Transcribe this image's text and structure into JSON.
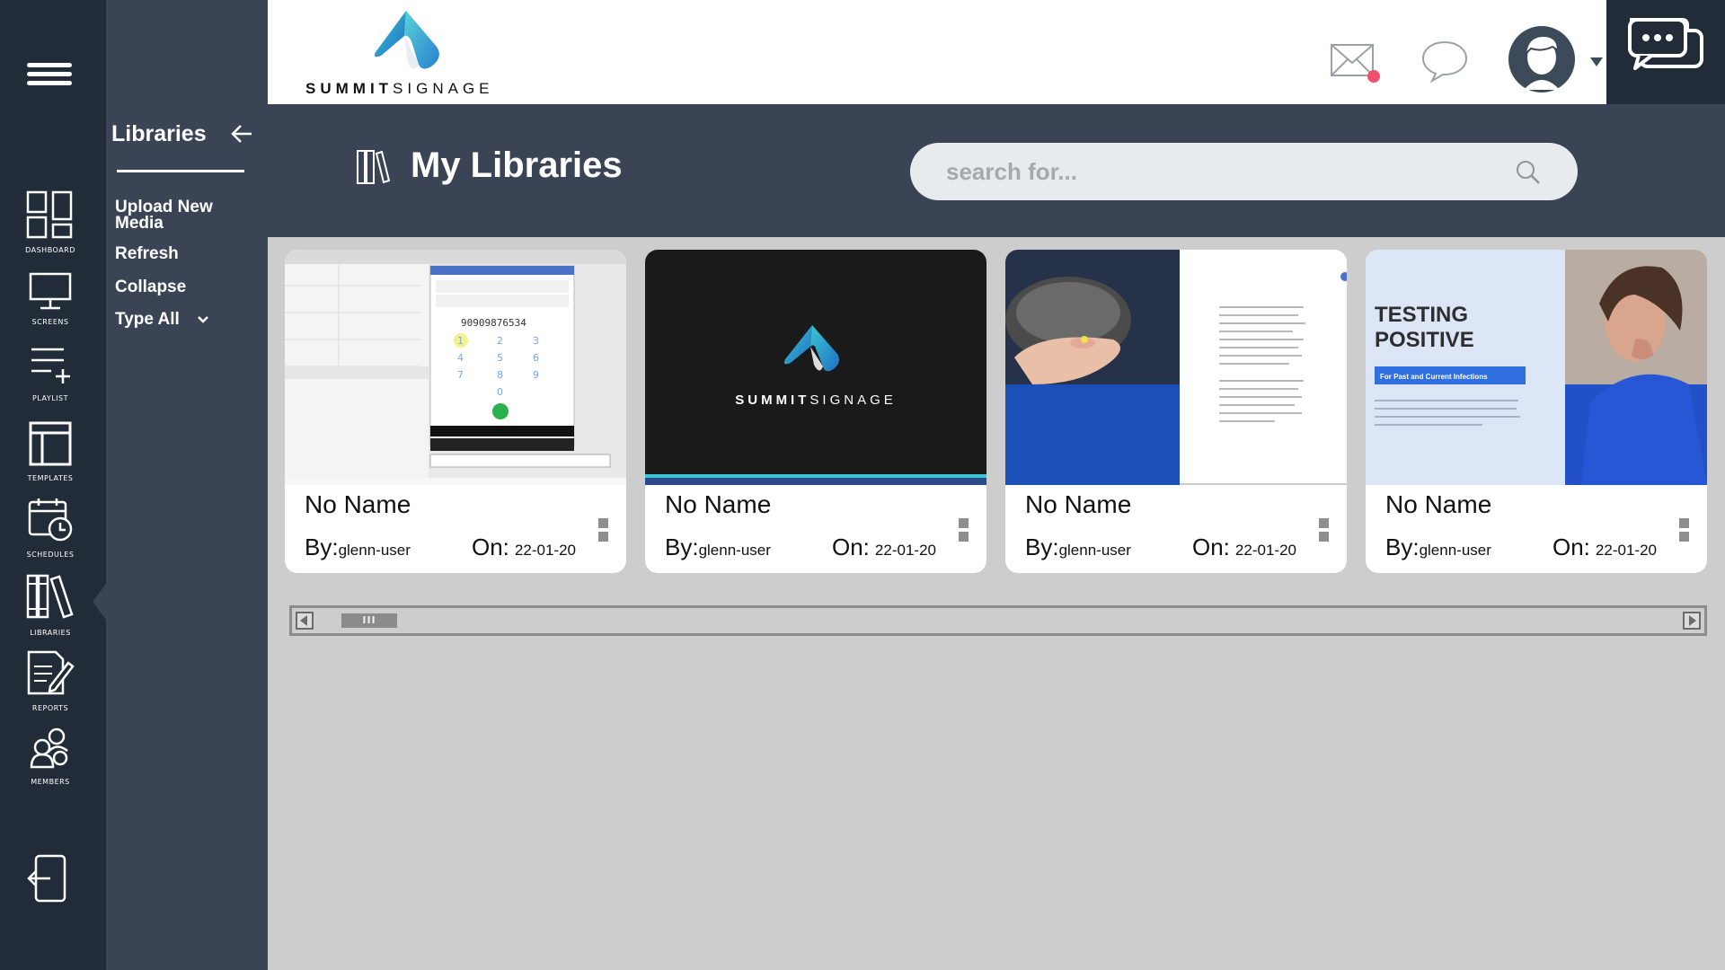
{
  "brand": {
    "name_bold": "SUMMIT",
    "name_light": "SIGNAGE"
  },
  "nav": {
    "items": [
      {
        "label": "Dashboard",
        "icon": "dashboard-icon"
      },
      {
        "label": "Screens",
        "icon": "monitor-icon"
      },
      {
        "label": "Playlist",
        "icon": "playlist-add-icon"
      },
      {
        "label": "Templates",
        "icon": "template-layout-icon"
      },
      {
        "label": "Schedules",
        "icon": "calendar-clock-icon"
      },
      {
        "label": "Libraries",
        "icon": "library-books-icon",
        "active": true
      },
      {
        "label": "Reports",
        "icon": "report-edit-icon"
      },
      {
        "label": "Members",
        "icon": "members-group-icon"
      }
    ],
    "logout_icon": "logout-icon"
  },
  "panel": {
    "title": "Libraries",
    "items": [
      "Upload New Media",
      "Refresh",
      "Collapse",
      "Type All"
    ]
  },
  "header": {
    "title": "My Libraries",
    "search_placeholder": "search for..."
  },
  "colors": {
    "rail": "#222b38",
    "panel": "#3a4454",
    "content_bg": "#cdcdcd",
    "brand_blue": "#2a7fcf",
    "brand_teal": "#3cc6d3",
    "notification_dot": "#f0506e"
  },
  "cards": [
    {
      "name": "No Name",
      "by_label": "By:",
      "by": "glenn-user",
      "on_label": "On:",
      "on": "22-01-20",
      "thumb": "phone-dialer-screenshot",
      "thumb_text": "90909876534"
    },
    {
      "name": "No Name",
      "by_label": "By:",
      "by": "glenn-user",
      "on_label": "On:",
      "on": "22-01-20",
      "thumb": "summit-signage-logo-dark"
    },
    {
      "name": "No Name",
      "by_label": "By:",
      "by": "glenn-user",
      "on_label": "On:",
      "on": "22-01-20",
      "thumb": "hand-with-pill-document"
    },
    {
      "name": "No Name",
      "by_label": "By:",
      "by": "glenn-user",
      "on_label": "On:",
      "on": "22-01-20",
      "thumb": "testing-positive-slide",
      "thumb_title": "TESTING POSITIVE",
      "thumb_badge": "For Past and Current Infections"
    }
  ]
}
